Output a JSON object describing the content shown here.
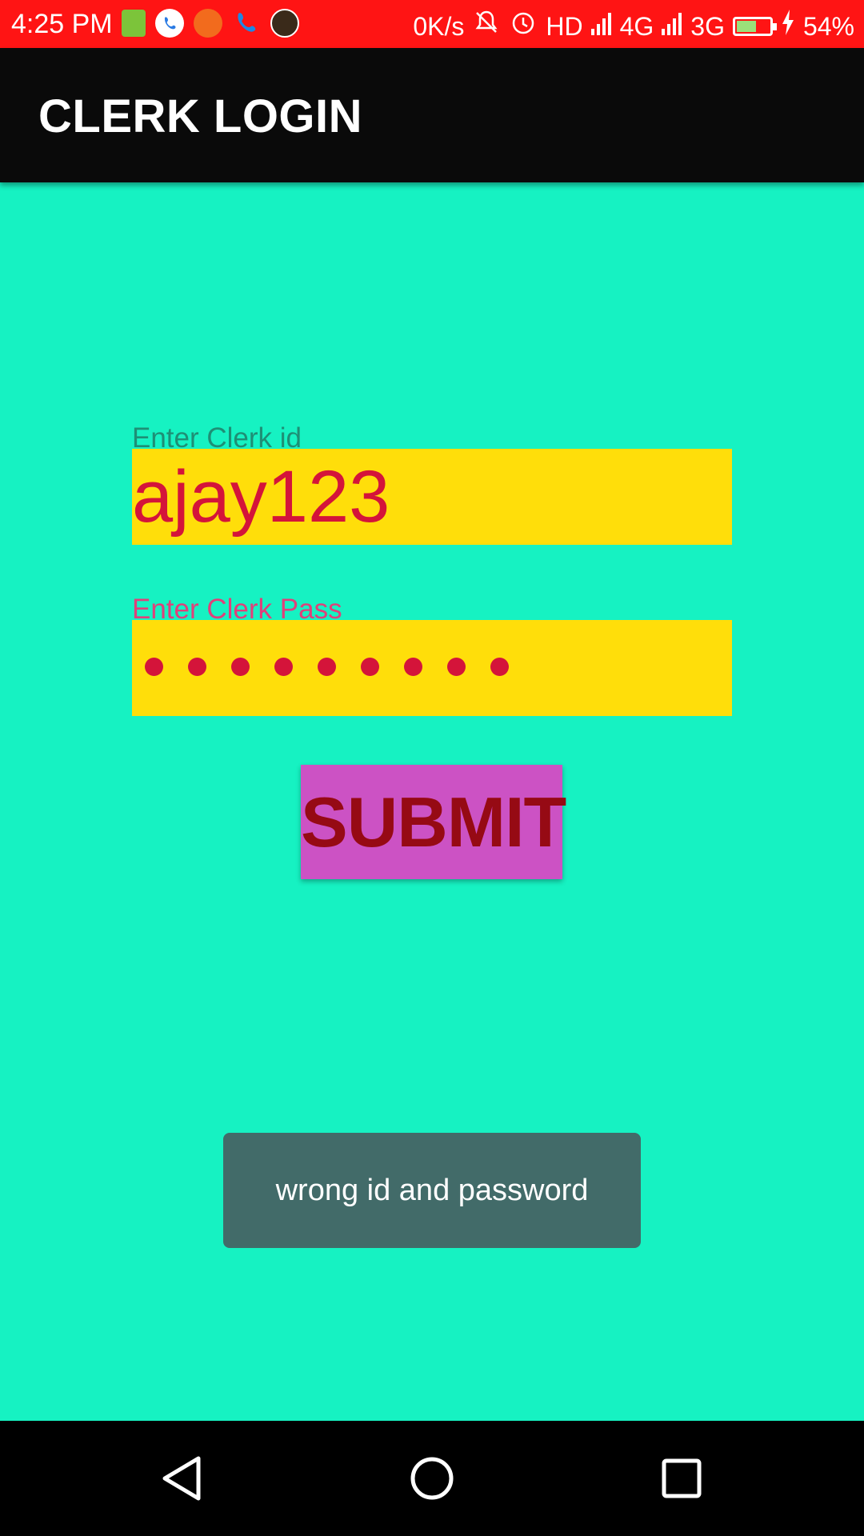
{
  "status_bar": {
    "time": "4:25 PM",
    "speed": "0K/s",
    "hd": "HD",
    "net1": "4G",
    "net2": "3G",
    "battery": "54%",
    "battery_level": 0.54,
    "background": "#FF1414",
    "notification_icons": [
      "message-icon",
      "phone-app-icon",
      "screenshot-icon",
      "call-icon",
      "call-recorder-icon"
    ],
    "system_icons": [
      "bell-off-icon",
      "alarm-icon",
      "signal-icon",
      "battery-icon",
      "charging-icon"
    ]
  },
  "app_bar": {
    "title": "CLERK LOGIN",
    "background": "#0A0A0A"
  },
  "form": {
    "id_label": "Enter Clerk id",
    "id_value": "ajay123",
    "pass_label": "Enter Clerk Pass",
    "pass_mask_count": 9,
    "submit_label": "SUBMIT",
    "field_bg": "#FFDE0A",
    "submit_bg": "#CC52C4",
    "page_bg": "#16F2C2"
  },
  "toast": {
    "message": "wrong id and password"
  },
  "nav_bar": {
    "icons": [
      "back-icon",
      "home-icon",
      "recents-icon"
    ]
  }
}
